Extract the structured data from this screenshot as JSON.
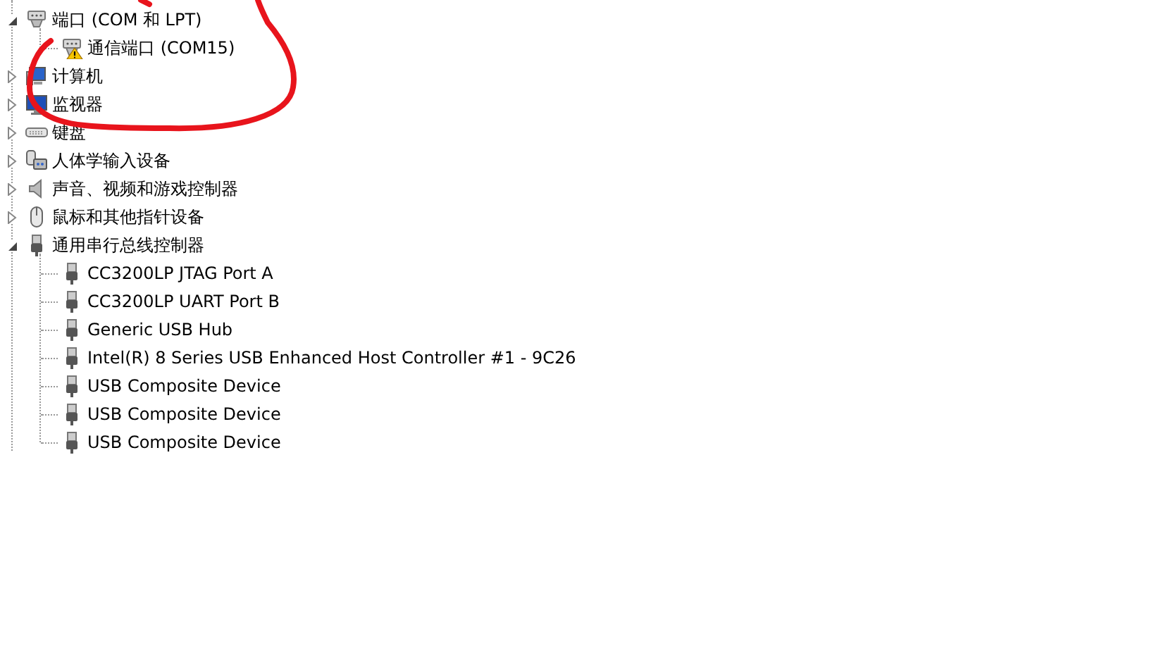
{
  "tree": [
    {
      "label": "端口 (COM 和 LPT)",
      "kind": "port",
      "expanded": true,
      "children": [
        {
          "label": "通信端口 (COM15)",
          "kind": "port",
          "warning": true
        }
      ]
    },
    {
      "label": "计算机",
      "kind": "computer",
      "expanded": false
    },
    {
      "label": "监视器",
      "kind": "monitor",
      "expanded": false
    },
    {
      "label": "键盘",
      "kind": "keyboard",
      "expanded": false
    },
    {
      "label": "人体学输入设备",
      "kind": "hid",
      "expanded": false
    },
    {
      "label": "声音、视频和游戏控制器",
      "kind": "sound",
      "expanded": false
    },
    {
      "label": "鼠标和其他指针设备",
      "kind": "mouse",
      "expanded": false
    },
    {
      "label": "通用串行总线控制器",
      "kind": "usb",
      "expanded": true,
      "children": [
        {
          "label": "CC3200LP JTAG Port A",
          "kind": "usb",
          "warning": false
        },
        {
          "label": "CC3200LP UART Port B",
          "kind": "usb",
          "warning": false
        },
        {
          "label": "Generic USB Hub",
          "kind": "usb",
          "warning": false
        },
        {
          "label": "Intel(R) 8 Series USB Enhanced Host Controller #1 - 9C26",
          "kind": "usb",
          "warning": false
        },
        {
          "label": "USB Composite Device",
          "kind": "usb",
          "warning": false
        },
        {
          "label": "USB Composite Device",
          "kind": "usb",
          "warning": false
        },
        {
          "label": "USB Composite Device",
          "kind": "usb",
          "warning": false
        }
      ]
    }
  ],
  "annotations": [
    {
      "kind": "freehand-circle"
    }
  ]
}
